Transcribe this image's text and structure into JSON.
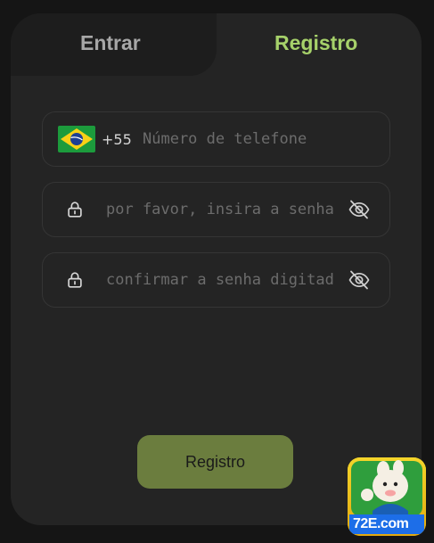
{
  "tabs": {
    "login_label": "Entrar",
    "register_label": "Registro"
  },
  "form": {
    "phone": {
      "country_flag": "brazil-flag",
      "country_code": "+55",
      "placeholder": "Número de telefone",
      "value": ""
    },
    "password": {
      "placeholder": "por favor, insira a senha",
      "value": ""
    },
    "confirm_password": {
      "placeholder": "confirmar a senha digitada",
      "value": ""
    },
    "submit_label": "Registro"
  },
  "brand": {
    "logo_text": "72E.com"
  },
  "colors": {
    "accent": "#a6d16a",
    "button": "#6b7d3e",
    "card": "#242424",
    "background": "#151515"
  }
}
